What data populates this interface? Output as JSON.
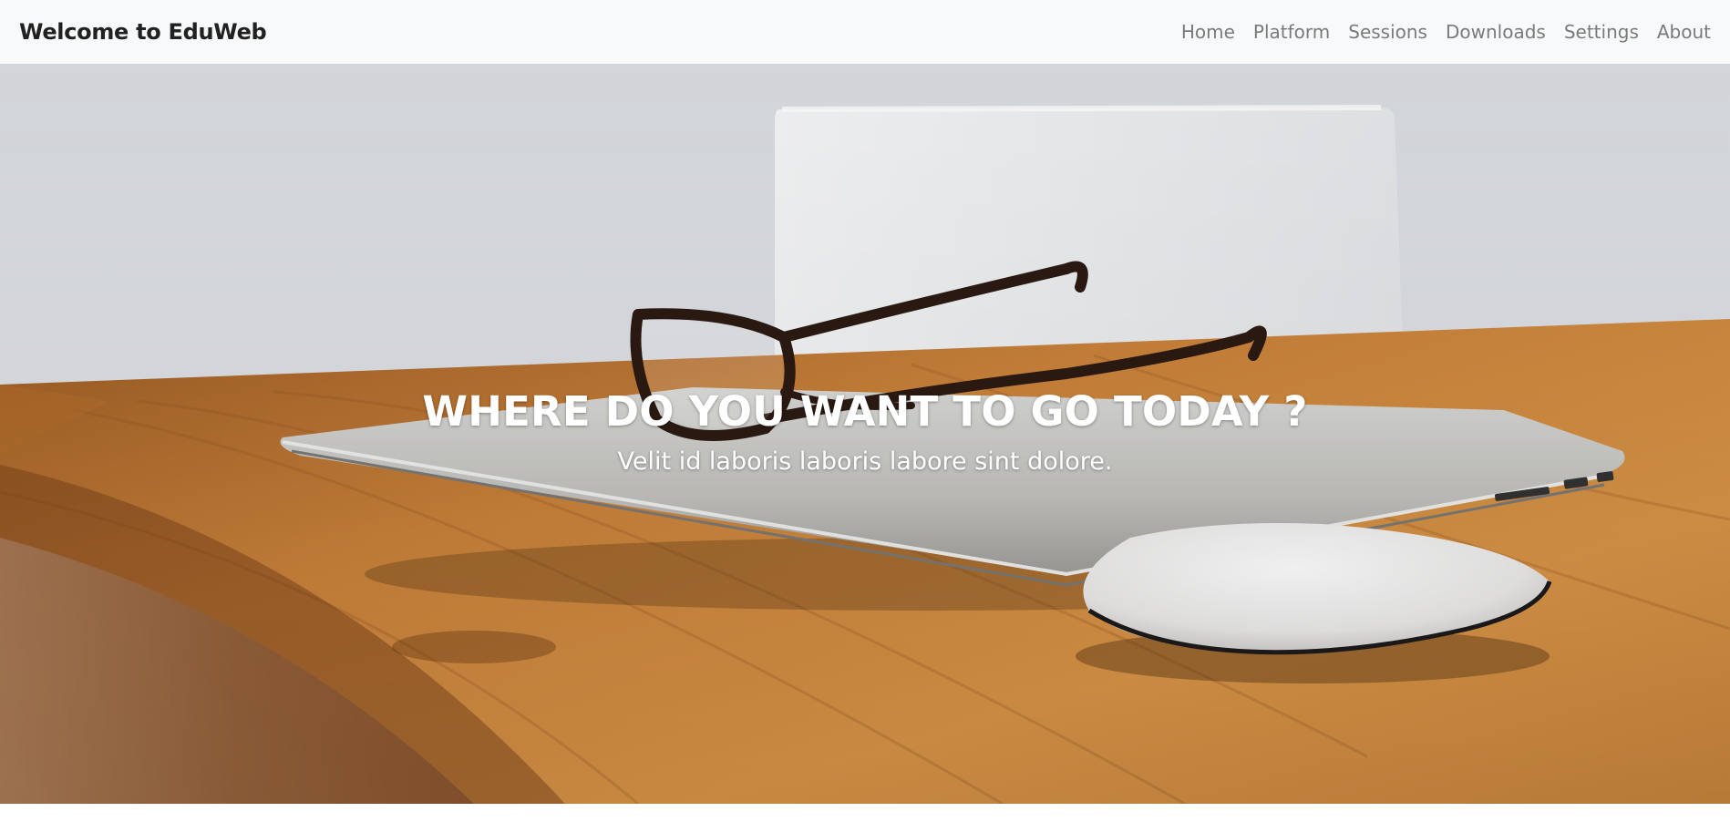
{
  "navbar": {
    "brand": "Welcome to EduWeb",
    "links": [
      {
        "label": "Home"
      },
      {
        "label": "Platform"
      },
      {
        "label": "Sessions"
      },
      {
        "label": "Downloads"
      },
      {
        "label": "Settings"
      },
      {
        "label": "About"
      }
    ]
  },
  "hero": {
    "title": "WHERE DO YOU WANT TO GO TODAY ?",
    "subtitle": "Velit id laboris laboris labore sint dolore.",
    "background_image": "desk-with-laptop-glasses-mouse"
  },
  "colors": {
    "navbar_bg": "#f8f9fa",
    "brand_text": "#212121",
    "nav_link": "#7a7a7a",
    "hero_text": "#ffffff",
    "wall": "#dcdfe3",
    "wood": "#c47a2c"
  }
}
